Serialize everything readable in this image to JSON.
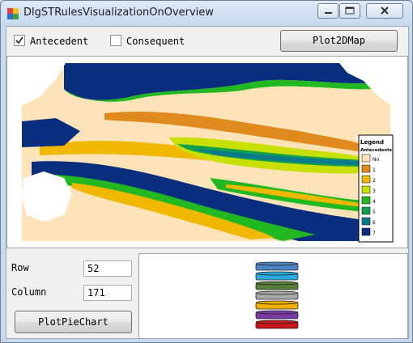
{
  "window": {
    "title": "DlgSTRulesVisualizationOnOverview"
  },
  "toolbar": {
    "antecedent_label": "Antecedent",
    "antecedent_checked": true,
    "consequent_label": "Consequent",
    "consequent_checked": false,
    "plot2d_label": "Plot2DMap"
  },
  "legend": {
    "title": "Legend",
    "subtitle": "Antecedents",
    "items": [
      {
        "label": "No",
        "color": "#fce4b8"
      },
      {
        "label": "1",
        "color": "#e08a1e"
      },
      {
        "label": "2",
        "color": "#f0b800"
      },
      {
        "label": "3",
        "color": "#c8e000"
      },
      {
        "label": "4",
        "color": "#22b822"
      },
      {
        "label": "5",
        "color": "#10a050"
      },
      {
        "label": "6",
        "color": "#0c7a8a"
      },
      {
        "label": "7",
        "color": "#0a2e7e"
      }
    ]
  },
  "fields": {
    "row_label": "Row",
    "row_value": "52",
    "column_label": "Column",
    "column_value": "171"
  },
  "pie_button_label": "PlotPieChart",
  "stack_colors": [
    "#4f86c6",
    "#29a9df",
    "#5a7d3a",
    "#a8a8a8",
    "#f0b000",
    "#7a3aa6",
    "#c8161d"
  ]
}
